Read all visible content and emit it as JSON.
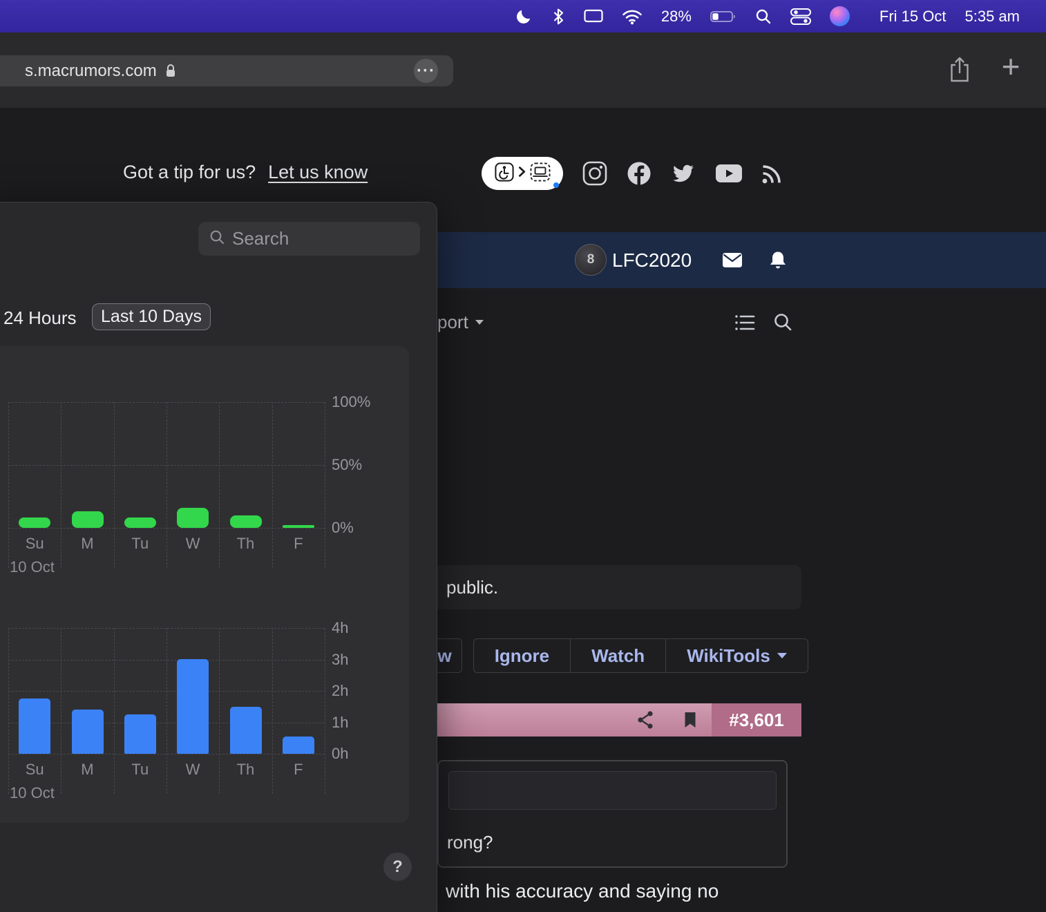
{
  "menubar": {
    "battery_percent": "28%",
    "date": "Fri 15 Oct",
    "time": "5:35 am"
  },
  "browser": {
    "url": "s.macrumors.com"
  },
  "icons": {
    "plus": "+",
    "ellipsis": "···"
  },
  "tip": {
    "text": "Got a tip for us?",
    "link_label": "Let us know"
  },
  "forum": {
    "username": "LFC2020",
    "nav_item_partial": "port",
    "notice_partial": "public.",
    "action_buttons": [
      {
        "label": "ew"
      },
      {
        "label": "Ignore"
      },
      {
        "label": "Watch"
      },
      {
        "label": "WikiTools"
      }
    ],
    "post_number": "#3,601",
    "quote_text_partial": "rong?",
    "post_text_partial": "with his accuracy and saying no"
  },
  "panel": {
    "search_placeholder": "Search",
    "tabs": [
      {
        "label": "24 Hours",
        "selected": false
      },
      {
        "label": "Last 10 Days",
        "selected": true
      }
    ],
    "help_label": "?"
  },
  "chart_data": [
    {
      "type": "bar",
      "categories": [
        "Su",
        "M",
        "Tu",
        "W",
        "Th",
        "F"
      ],
      "values": [
        8,
        13,
        8,
        16,
        10,
        2
      ],
      "unit": "%",
      "ylim": [
        0,
        100
      ],
      "tick_labels": [
        "100%",
        "50%",
        "0%"
      ],
      "bar_color": "#32d74b",
      "annotation": "10 Oct",
      "grid": "dashed",
      "legend": "none"
    },
    {
      "type": "bar",
      "categories": [
        "Su",
        "M",
        "Tu",
        "W",
        "Th",
        "F"
      ],
      "values": [
        1.75,
        1.4,
        1.25,
        3.0,
        1.5,
        0.55
      ],
      "unit": "h",
      "ylim": [
        0,
        4
      ],
      "tick_labels": [
        "4h",
        "3h",
        "2h",
        "1h",
        "0h"
      ],
      "bar_color": "#3b82f7",
      "annotation": "10 Oct",
      "grid": "dashed",
      "legend": "none"
    }
  ]
}
